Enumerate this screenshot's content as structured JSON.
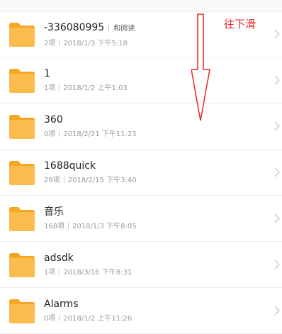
{
  "folders": [
    {
      "name": "-336080995",
      "tag": "和阅读",
      "count": "2项",
      "date": "2018/1/3 下午5:18"
    },
    {
      "name": "1",
      "count": "1项",
      "date": "2018/1/2 上午1:03"
    },
    {
      "name": "360",
      "count": "0项",
      "date": "2018/2/21 下午11:23"
    },
    {
      "name": "1688quick",
      "count": "29项",
      "date": "2018/2/15 下午3:40"
    },
    {
      "name": "音乐",
      "count": "168项",
      "date": "2018/1/3 下午8:05"
    },
    {
      "name": "adsdk",
      "count": "1项",
      "date": "2018/3/16 下午8:31"
    },
    {
      "name": "Alarms",
      "count": "0项",
      "date": "2018/1/2 上午11:26"
    }
  ],
  "annotation": {
    "label": "往下滑",
    "color": "#e8262a"
  },
  "icons": {
    "folder": "folder-icon",
    "chevron": "chevron-right-icon",
    "arrow": "down-arrow-icon"
  },
  "colors": {
    "folder_body": "#fbbc4e",
    "folder_tab": "#f5a623",
    "divider": "#ededed"
  }
}
